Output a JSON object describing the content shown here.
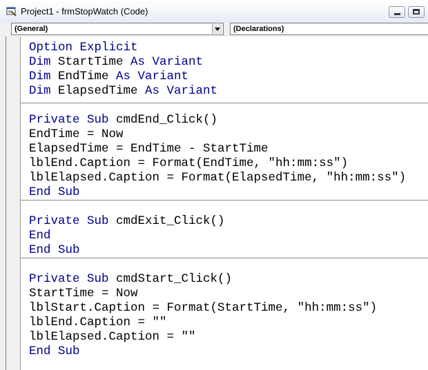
{
  "window": {
    "title": "Project1 - frmStopWatch (Code)"
  },
  "combos": {
    "object": "(General)",
    "procedure": "(Declarations)"
  },
  "code": {
    "declarations": [
      {
        "kw1": "Option Explicit",
        "rest": ""
      },
      {
        "kw1": "Dim",
        "name": " StartTime ",
        "kw2": "As Variant"
      },
      {
        "kw1": "Dim",
        "name": " EndTime ",
        "kw2": "As Variant"
      },
      {
        "kw1": "Dim",
        "name": " ElapsedTime ",
        "kw2": "As Variant"
      }
    ],
    "cmdEnd": {
      "header_kw": "Private Sub",
      "header_name": " cmdEnd_Click()",
      "body": [
        "EndTime = Now",
        "ElapsedTime = EndTime - StartTime",
        "lblEnd.Caption = Format(EndTime, \"hh:mm:ss\")",
        "lblElapsed.Caption = Format(ElapsedTime, \"hh:mm:ss\")"
      ],
      "end": "End Sub"
    },
    "cmdExit": {
      "header_kw": "Private Sub",
      "header_name": " cmdExit_Click()",
      "body_kw": "End",
      "end": "End Sub"
    },
    "cmdStart": {
      "header_kw": "Private Sub",
      "header_name": " cmdStart_Click()",
      "body": [
        "StartTime = Now",
        "lblStart.Caption = Format(StartTime, \"hh:mm:ss\")",
        "lblEnd.Caption = \"\"",
        "lblElapsed.Caption = \"\""
      ],
      "end": "End Sub"
    }
  }
}
